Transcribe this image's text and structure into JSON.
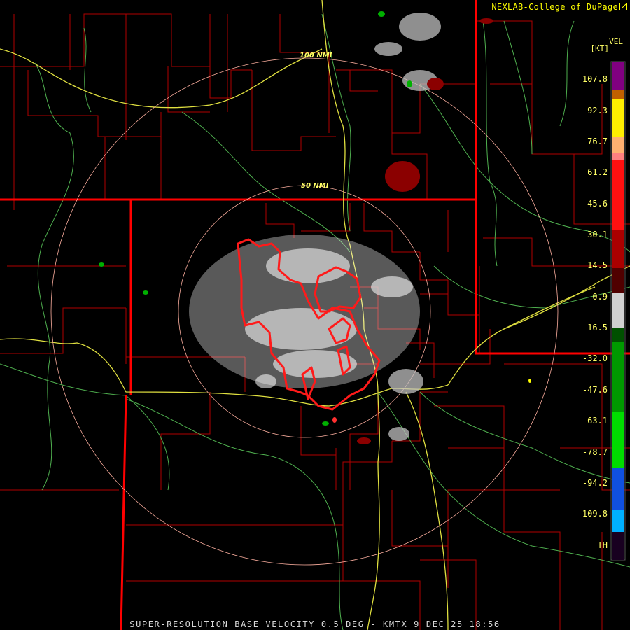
{
  "header": {
    "brand": "NEXLAB-College of DuPage"
  },
  "caption": "SUPER-RESOLUTION BASE VELOCITY 0.5 DEG - KMTX 9 DEC 25 18:56",
  "legend": {
    "title": "VEL",
    "unit": "[KT]",
    "ticks": [
      "107.8",
      "92.3",
      "76.7",
      "61.2",
      "45.6",
      "30.1",
      "14.5",
      "-0.9",
      "-16.5",
      "-32.0",
      "-47.6",
      "-63.1",
      "-78.7",
      "-94.2",
      "-109.8",
      "TH"
    ],
    "colors": {
      "purple": "#8a0a8a",
      "yellow": "#ffff00",
      "orange": "#ffaa66",
      "red": "#ff1010",
      "dark_red": "#6a0000",
      "gray": "#c0c0c0",
      "green": "#00cc00",
      "blue": "#1060ff",
      "cyan": "#00bfff",
      "range_folded": "#2a0a3a"
    }
  },
  "map": {
    "radar_site": "KMTX",
    "range_rings": [
      "50 NMI",
      "100 NMI"
    ],
    "warning_polygon_color": "#ff1a1a",
    "state_line_color": "#ff0000",
    "county_line_color": "#b00000",
    "highway_color": "#e0e040",
    "river_color": "#60c060"
  }
}
